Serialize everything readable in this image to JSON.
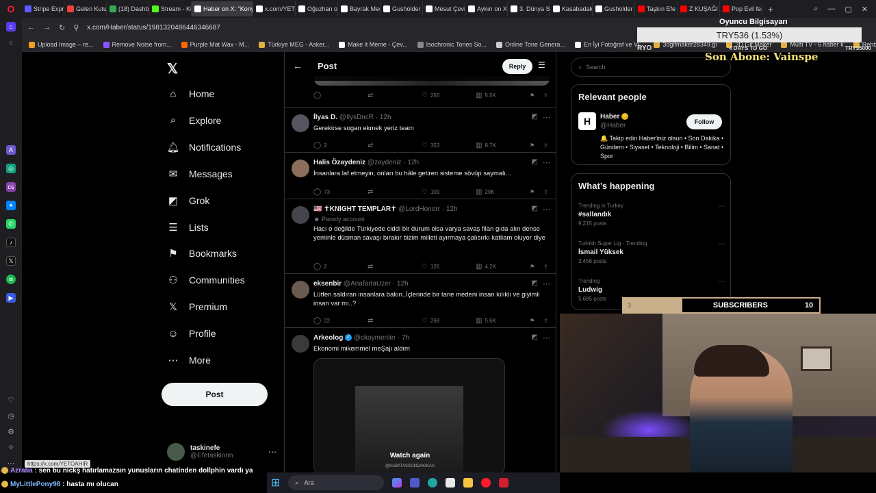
{
  "browser": {
    "tabs": [
      {
        "label": "Stripe Expr",
        "color": "#635bff"
      },
      {
        "label": "Gelen Kutus",
        "color": "#ea4335"
      },
      {
        "label": "(18) Dashb",
        "color": "#34a853"
      },
      {
        "label": "Stream - Ki",
        "color": "#53fc18"
      },
      {
        "label": "Haber on X: \"Konya",
        "color": "#ffffff",
        "active": true
      },
      {
        "label": "x.com/YETO",
        "color": "#ffffff"
      },
      {
        "label": "Oğuzhan or",
        "color": "#ffffff"
      },
      {
        "label": "Bayrak Med",
        "color": "#ffffff"
      },
      {
        "label": "Gusholder",
        "color": "#ffffff"
      },
      {
        "label": "Mesut Çevi",
        "color": "#ffffff"
      },
      {
        "label": "Aykırı on X",
        "color": "#ffffff"
      },
      {
        "label": "3. Dünya Sa",
        "color": "#ffffff"
      },
      {
        "label": "Kasabadaki",
        "color": "#ffffff"
      },
      {
        "label": "Gusholder",
        "color": "#ffffff"
      },
      {
        "label": "Taşkın Efe",
        "color": "#ff0000"
      },
      {
        "label": "Z KUŞAĞI A",
        "color": "#ff0000"
      },
      {
        "label": "Pop Evil fea",
        "color": "#ff0000"
      }
    ],
    "url": "x.com/Haber/status/1981320486446346687",
    "bookmarks": [
      {
        "label": "Upload Image – re...",
        "color": "#f0a020"
      },
      {
        "label": "Remove Noise from...",
        "color": "#8855ff"
      },
      {
        "label": "Purple Mat Wax - M...",
        "color": "#ff6600"
      },
      {
        "label": "Türkiye MEG - Asker...",
        "color": "#e0b040"
      },
      {
        "label": "Make it Meme - Çev...",
        "color": "#ffffff"
      },
      {
        "label": "Isochronic Tones So...",
        "color": "#888888"
      },
      {
        "label": "Online Tone Genera...",
        "color": "#cccccc"
      },
      {
        "label": "En İyi Fotoğraf ve Vi...",
        "color": "#ffffff"
      },
      {
        "label": "3dgifmaker28349.gi",
        "color": "#e0b040"
      },
      {
        "label": "3D Gif Maker",
        "color": "#e0b040"
      },
      {
        "label": "Multi TV - 6 haber k",
        "color": "#e0b040"
      },
      {
        "label": "Rehber: Windows 1...",
        "color": "#e0b040"
      }
    ],
    "tooltip_url": "https://x.com/YETOAHIR"
  },
  "nav": {
    "items": [
      {
        "label": "Home",
        "icon": "⌂",
        "name": "home"
      },
      {
        "label": "Explore",
        "icon": "⌕",
        "name": "explore"
      },
      {
        "label": "Notifications",
        "icon": "🔔︎",
        "name": "notifications"
      },
      {
        "label": "Messages",
        "icon": "✉",
        "name": "messages"
      },
      {
        "label": "Grok",
        "icon": "◩",
        "name": "grok"
      },
      {
        "label": "Lists",
        "icon": "☰",
        "name": "lists"
      },
      {
        "label": "Bookmarks",
        "icon": "⚑",
        "name": "bookmarks"
      },
      {
        "label": "Communities",
        "icon": "⚇",
        "name": "communities"
      },
      {
        "label": "Premium",
        "icon": "𝕏",
        "name": "premium"
      },
      {
        "label": "Profile",
        "icon": "☺",
        "name": "profile"
      },
      {
        "label": "More",
        "icon": "⋯",
        "name": "more"
      }
    ],
    "post_label": "Post",
    "account": {
      "name": "taskinefe",
      "handle": "@Efetaskinnn"
    }
  },
  "feed": {
    "title": "Post",
    "reply_label": "Reply",
    "top_stats": {
      "likes": "256",
      "views": "5.5K"
    },
    "tweets": [
      {
        "name": "İlyas D.",
        "handle": "@IlysDncR",
        "time": "12h",
        "text": "Gerekirse sogan ekmek yeriz team",
        "replies": "2",
        "likes": "353",
        "views": "8.7K",
        "avatar": "#555560"
      },
      {
        "name": "Halis Özaydeniz",
        "handle": "@zaydeniz",
        "time": "12h",
        "text": "İnsanlara laf etmeyin, onları bu hâle getiren sisteme sövüp saymalı...",
        "replies": "73",
        "likes": "109",
        "views": "20K",
        "avatar": "#8a6d5a"
      },
      {
        "name": "🇺🇸 ✝KNIGHT TEMPLAR✝",
        "handle": "@LordHonorr",
        "time": "12h",
        "parody": "Parody account",
        "text": "Hacı o değilde Türkiyede ciddi bir durum olsa varya savaş filan gıda alın dense yeminle düsman savaşı bırakır bizim milleti ayırmaya çalısırkı katliam oluyor diye",
        "replies": "2",
        "likes": "126",
        "views": "4.2K",
        "avatar": "#44444c"
      },
      {
        "name": "eksenbir",
        "handle": "@AnafartaUzer",
        "time": "12h",
        "text": "Lütfen saldıran insanlara bakın..İçlerinde bir tane medeni insan kılıklı ve giyimli insan var mı..?",
        "replies": "22",
        "likes": "268",
        "views": "5.6K",
        "avatar": "#6a5a50"
      },
      {
        "name": "Arkeolog",
        "handle": "@ckoymenler",
        "time": "7h",
        "text": "Ekonomi  mikemmel meŞajı aldım",
        "avatar": "#3a3a3a",
        "video_label": "Watch again",
        "video_watermark": "@KABATASSONDAKIKAA"
      }
    ]
  },
  "sidebar": {
    "search_placeholder": "Search",
    "relevant_title": "Relevant people",
    "person": {
      "initial": "H",
      "name": "Haber",
      "handle": "@Haber",
      "follow_label": "Follow",
      "bio": "🔔 Takip edin Haber'iniz olsun • Son Dakika • Gündem • Siyaset • Teknoloji • Bilim • Sanat • Spor"
    },
    "happening_title": "What’s happening",
    "trends": [
      {
        "context": "Trending in Turkey",
        "name": "#sallandık",
        "count": "9,215 posts"
      },
      {
        "context": "Turkish Super Lig · Trending",
        "name": "İsmail Yüksek",
        "count": "3,456 posts"
      },
      {
        "context": "Trending",
        "name": "Ludwig",
        "count": "5,685 posts"
      }
    ]
  },
  "stream_overlay": {
    "goal_title": "Oyuncu Bilgisayarı",
    "goal_value": "TRY536 (1.53%)",
    "goal_progress": 0.0153,
    "goal_left": "RYO",
    "goal_days": "4 DAYS TO GO",
    "goal_target": "TRY35000",
    "last_sub": "Son Abone: Vainspe",
    "subs_current": "3",
    "subs_label": "SUBSCRIBERS",
    "subs_target": "10",
    "subs_progress": 0.3,
    "chat": [
      {
        "user": "Azralia",
        "message": " : sen bu nickş hatırlamazsın yunusların chatinden dollphin vardı ya"
      },
      {
        "user": "MyLittlePony98",
        "message": " : hasta mı olucan"
      }
    ]
  },
  "taskbar": {
    "search_label": "Ara"
  }
}
